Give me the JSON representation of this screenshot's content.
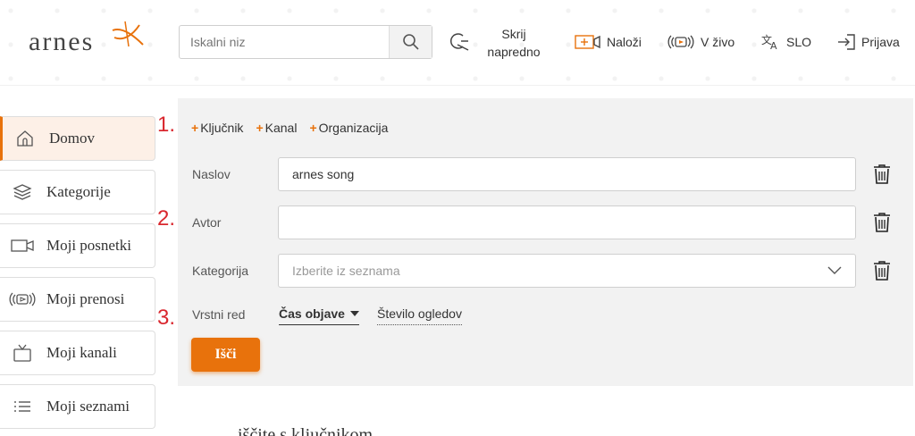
{
  "header": {
    "logo_text": "arnes",
    "search_placeholder": "Iskalni niz",
    "advanced_line1": "Skrij",
    "advanced_line2": "napredno",
    "upload_label": "Naloži",
    "live_label": "V živo",
    "language_label": "SLO",
    "login_label": "Prijava",
    "accent_color": "#e8720c"
  },
  "sidebar": {
    "items": [
      {
        "label": "Domov",
        "icon": "home-icon",
        "active": true
      },
      {
        "label": "Kategorije",
        "icon": "layers-icon"
      },
      {
        "label": "Moji posnetki",
        "icon": "video-camera-icon"
      },
      {
        "label": "Moji prenosi",
        "icon": "broadcast-icon"
      },
      {
        "label": "Moji kanali",
        "icon": "tv-icon"
      },
      {
        "label": "Moji seznami",
        "icon": "list-icon"
      }
    ]
  },
  "filters": {
    "links": [
      "Ključnik",
      "Kanal",
      "Organizacija"
    ],
    "title_label": "Naslov",
    "title_value": "arnes song",
    "author_label": "Avtor",
    "author_value": "",
    "category_label": "Kategorija",
    "category_placeholder": "Izberite iz seznama",
    "sort_label": "Vrstni red",
    "sort_active": "Čas objave",
    "sort_alt": "Število ogledov",
    "search_button": "Išči"
  },
  "steps": [
    "1.",
    "2.",
    "3."
  ],
  "below_text": "... ... iščite s ključnikom ..."
}
